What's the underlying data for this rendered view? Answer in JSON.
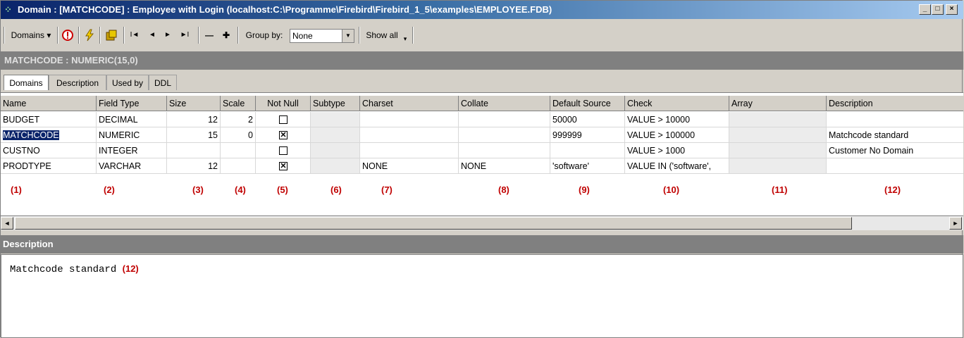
{
  "window": {
    "title": "Domain : [MATCHCODE] : Employee with Login (localhost:C:\\Programme\\Firebird\\Firebird_1_5\\examples\\EMPLOYEE.FDB)",
    "controls": [
      "_",
      "□",
      "×"
    ]
  },
  "toolbar": {
    "domains_label": "Domains ▾",
    "group_by_label": "Group by:",
    "group_by_value": "None",
    "show_all_label": "Show all",
    "nav_first": "I◄",
    "nav_prev": "◄",
    "nav_next": "►",
    "nav_last": "►I",
    "minus": "—",
    "plus": "✚"
  },
  "header": {
    "title": "MATCHCODE : NUMERIC(15,0)"
  },
  "tabs": [
    "Domains",
    "Description",
    "Used by",
    "DDL"
  ],
  "grid": {
    "columns": [
      "Name",
      "Field Type",
      "Size",
      "Scale",
      "Not Null",
      "Subtype",
      "Charset",
      "Collate",
      "Default Source",
      "Check",
      "Array",
      "Description"
    ],
    "rows": [
      {
        "name": "BUDGET",
        "field_type": "DECIMAL",
        "size": "12",
        "scale": "2",
        "not_null": false,
        "subtype": "",
        "charset": "",
        "collate": "",
        "default_source": "50000",
        "check": "VALUE > 10000",
        "array": "",
        "description": ""
      },
      {
        "name": "MATCHCODE",
        "field_type": "NUMERIC",
        "size": "15",
        "scale": "0",
        "not_null": true,
        "subtype": "",
        "charset": "",
        "collate": "",
        "default_source": "999999",
        "check": "VALUE > 100000",
        "array": "",
        "description": "Matchcode standard"
      },
      {
        "name": "CUSTNO",
        "field_type": "INTEGER",
        "size": "",
        "scale": "",
        "not_null": false,
        "subtype": "",
        "charset": "",
        "collate": "",
        "default_source": "",
        "check": "VALUE > 1000",
        "array": "",
        "description": "Customer No Domain"
      },
      {
        "name": "PRODTYPE",
        "field_type": "VARCHAR",
        "size": "12",
        "scale": "",
        "not_null": true,
        "subtype": "",
        "charset": "NONE",
        "collate": "NONE",
        "default_source": "'software'",
        "check": "VALUE IN ('software',",
        "array": "",
        "description": ""
      }
    ],
    "annotations": [
      "(1)",
      "(2)",
      "(3)",
      "(4)",
      "(5)",
      "(6)",
      "(7)",
      "(8)",
      "(9)",
      "(10)",
      "(11)",
      "(12)"
    ]
  },
  "description_panel": {
    "title": "Description",
    "text": "Matchcode standard",
    "annotation": "(12)"
  },
  "colors": {
    "title_start": "#0a246a",
    "title_end": "#a6caf0",
    "annotation": "#c00000",
    "selection": "#0a246a"
  }
}
